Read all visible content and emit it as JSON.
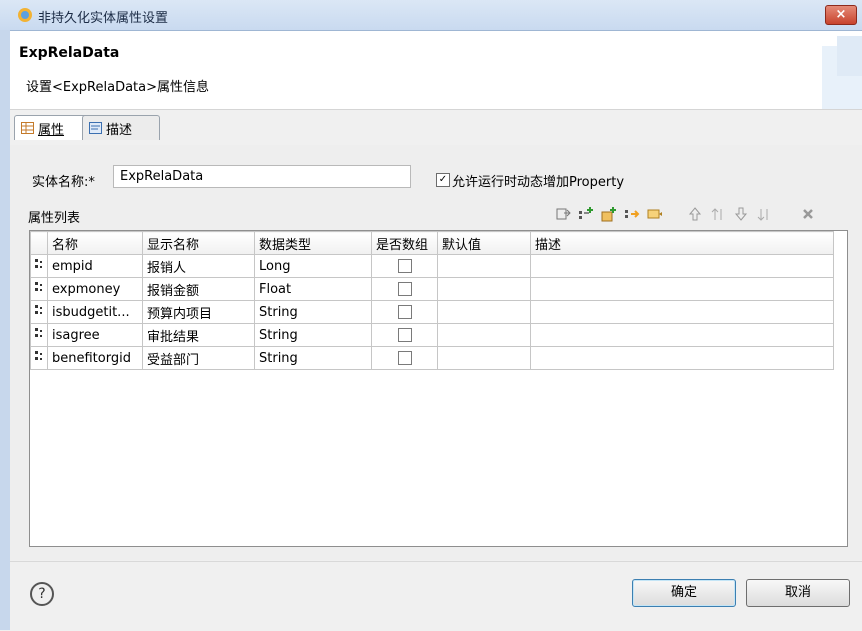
{
  "window": {
    "title": "非持久化实体属性设置",
    "close_label": "×"
  },
  "header": {
    "title": "ExpRelaData",
    "description": "设置<ExpRelaData>属性信息"
  },
  "tabs": [
    {
      "label": "属性",
      "active": true
    },
    {
      "label": "描述",
      "active": false
    }
  ],
  "form": {
    "entity_name_label": "实体名称:*",
    "entity_name_value": "ExpRelaData",
    "allow_dynamic_label": "允许运行时动态增加Property",
    "allow_dynamic_checked": true,
    "property_list_label": "属性列表"
  },
  "toolbar": {
    "icons": [
      "import-icon",
      "add-row-icon",
      "add-child-icon",
      "insert-icon",
      "edit-icon",
      "move-up-icon",
      "move-top-icon",
      "move-down-icon",
      "move-bottom-icon",
      "delete-icon"
    ]
  },
  "table": {
    "columns": [
      "名称",
      "显示名称",
      "数据类型",
      "是否数组",
      "默认值",
      "描述"
    ],
    "rows": [
      {
        "name": "empid",
        "display": "报销人",
        "type": "Long",
        "is_array": false,
        "default": "",
        "desc": ""
      },
      {
        "name": "expmoney",
        "display": "报销金额",
        "type": "Float",
        "is_array": false,
        "default": "",
        "desc": ""
      },
      {
        "name": "isbudgetit...",
        "display": "预算内项目",
        "type": "String",
        "is_array": false,
        "default": "",
        "desc": ""
      },
      {
        "name": "isagree",
        "display": "审批结果",
        "type": "String",
        "is_array": false,
        "default": "",
        "desc": ""
      },
      {
        "name": "benefitorgid",
        "display": "受益部门",
        "type": "String",
        "is_array": false,
        "default": "",
        "desc": ""
      }
    ]
  },
  "buttons": {
    "help": "?",
    "ok": "确定",
    "cancel": "取消"
  }
}
